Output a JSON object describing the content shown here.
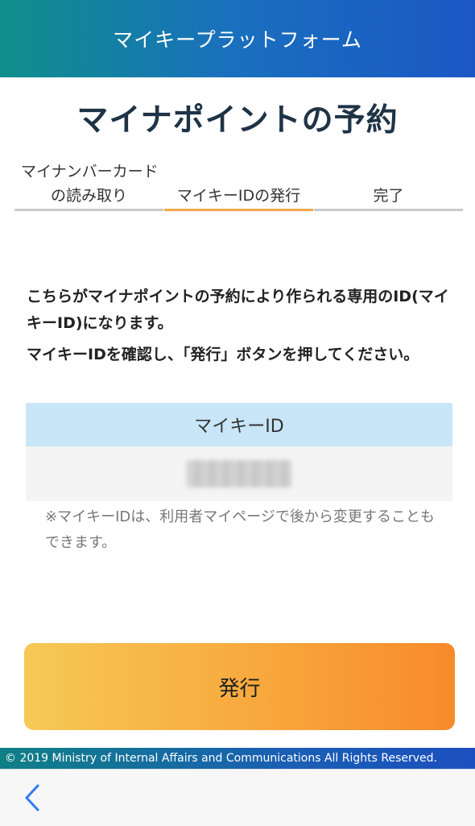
{
  "header": {
    "title": "マイキープラットフォーム"
  },
  "page": {
    "title": "マイナポイントの予約"
  },
  "steps": [
    {
      "line1": "マイナンバーカード",
      "line2": "の読み取り"
    },
    {
      "line1": "",
      "line2": "マイキーIDの発行"
    },
    {
      "line1": "",
      "line2": "完了"
    }
  ],
  "active_step_index": 1,
  "description": {
    "paragraph1": "こちらがマイナポイントの予約により作られる専用のID(マイキーID)になります。",
    "paragraph2": "マイキーIDを確認し、「発行」ボタンを押してください。"
  },
  "id_table": {
    "header": "マイキーID",
    "value": ""
  },
  "note": "※マイキーIDは、利用者マイページで後から変更することもできます。",
  "issue_button": {
    "label": "発行"
  },
  "footer": {
    "copyright": "© 2019 Ministry of Internal Affairs and Communications All Rights Reserved."
  },
  "navigation": {
    "back_icon": "chevron-left-icon"
  },
  "colors": {
    "header_gradient_start": "#0f8f8a",
    "header_gradient_end": "#1b57c4",
    "active_step": "#f3a84a",
    "id_header_bg": "#c8e6f7",
    "button_gradient_start": "#f6c956",
    "button_gradient_end": "#f88a2a",
    "back_icon": "#2f7cf6"
  }
}
